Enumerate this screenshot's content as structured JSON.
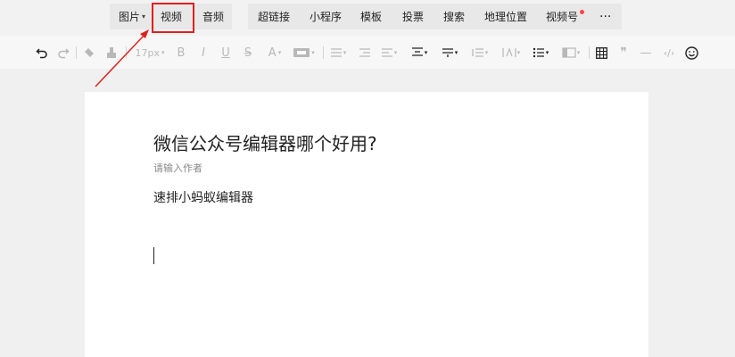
{
  "insert_toolbar": {
    "image": "图片",
    "video": "视频",
    "audio": "音频",
    "hyperlink": "超链接",
    "miniprogram": "小程序",
    "template": "模板",
    "vote": "投票",
    "search": "搜索",
    "location": "地理位置",
    "channels": "视频号",
    "more": "···"
  },
  "format_toolbar": {
    "font_size": "17px",
    "bold": "B",
    "italic": "I",
    "underline": "U",
    "strikethrough": "S",
    "font_color": "A",
    "quote": "❞",
    "divider": "—",
    "code": "‹/›"
  },
  "article": {
    "title": "微信公众号编辑器哪个好用?",
    "author_placeholder": "请输入作者",
    "body": "速排小蚂蚁编辑器"
  },
  "colors": {
    "highlight": "#e0201f",
    "background": "#f0f0f0",
    "paper": "#ffffff"
  }
}
